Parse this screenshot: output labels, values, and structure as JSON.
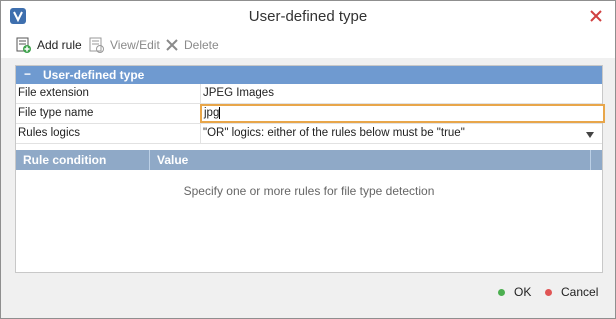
{
  "window": {
    "title": "User-defined type"
  },
  "toolbar": {
    "add_rule": "Add rule",
    "view_edit": "View/Edit",
    "delete": "Delete"
  },
  "properties": {
    "group_title": "User-defined type",
    "file_extension_label": "File extension",
    "file_extension_value": "JPEG Images",
    "file_type_name_label": "File type name",
    "file_type_name_value": "jpg",
    "rules_logics_label": "Rules logics",
    "rules_logics_value": "\"OR\" logics: either of the rules below must be \"true\""
  },
  "rules": {
    "col_condition": "Rule condition",
    "col_value": "Value",
    "empty_text": "Specify one or more rules for file type detection"
  },
  "footer": {
    "ok": "OK",
    "cancel": "Cancel"
  },
  "colors": {
    "group_header": "#6f9ad0",
    "table_header": "#8fa9c7",
    "input_focus": "#e8a64a",
    "ok_dot": "#4caf50",
    "cancel_dot": "#e05555"
  },
  "icons": {
    "app": "app-logo-icon",
    "close": "close-icon",
    "add_rule": "add-rule-icon",
    "view_edit": "view-edit-icon",
    "delete": "delete-icon",
    "dropdown": "chevron-down-icon"
  }
}
